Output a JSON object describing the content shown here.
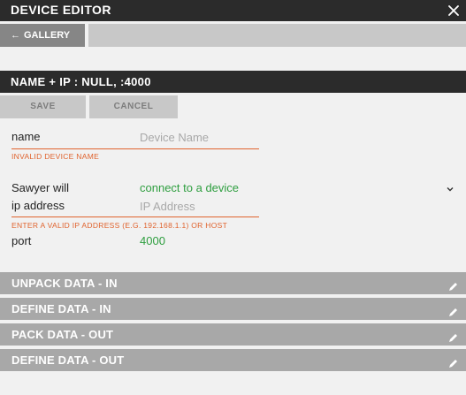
{
  "window": {
    "title": "DEVICE EDITOR",
    "close_icon": "close-icon"
  },
  "nav": {
    "gallery_label": "GALLERY",
    "arrow": "←"
  },
  "section": {
    "title": "NAME + IP : NULL, :4000"
  },
  "actions": {
    "save_label": "SAVE",
    "cancel_label": "CANCEL"
  },
  "form": {
    "name": {
      "label": "name",
      "placeholder": "Device Name",
      "value": "",
      "error": "INVALID DEVICE NAME"
    },
    "mode": {
      "label": "Sawyer will",
      "selected": "connect to a device"
    },
    "ip": {
      "label": "ip address",
      "placeholder": "IP Address",
      "value": "",
      "error": "ENTER A VALID IP ADDRESS (E.G. 192.168.1.1) OR HOST"
    },
    "port": {
      "label": "port",
      "value": "4000"
    }
  },
  "panels": [
    {
      "label": "UNPACK DATA - IN",
      "icon": "pencil-icon"
    },
    {
      "label": "DEFINE DATA - IN",
      "icon": "pencil-icon"
    },
    {
      "label": "PACK DATA - OUT",
      "icon": "pencil-icon"
    },
    {
      "label": "DEFINE DATA - OUT",
      "icon": "pencil-icon"
    }
  ],
  "colors": {
    "dark": "#2b2b2b",
    "error": "#e0632e",
    "green": "#2e9e3f",
    "panel": "#a8a8a8"
  }
}
